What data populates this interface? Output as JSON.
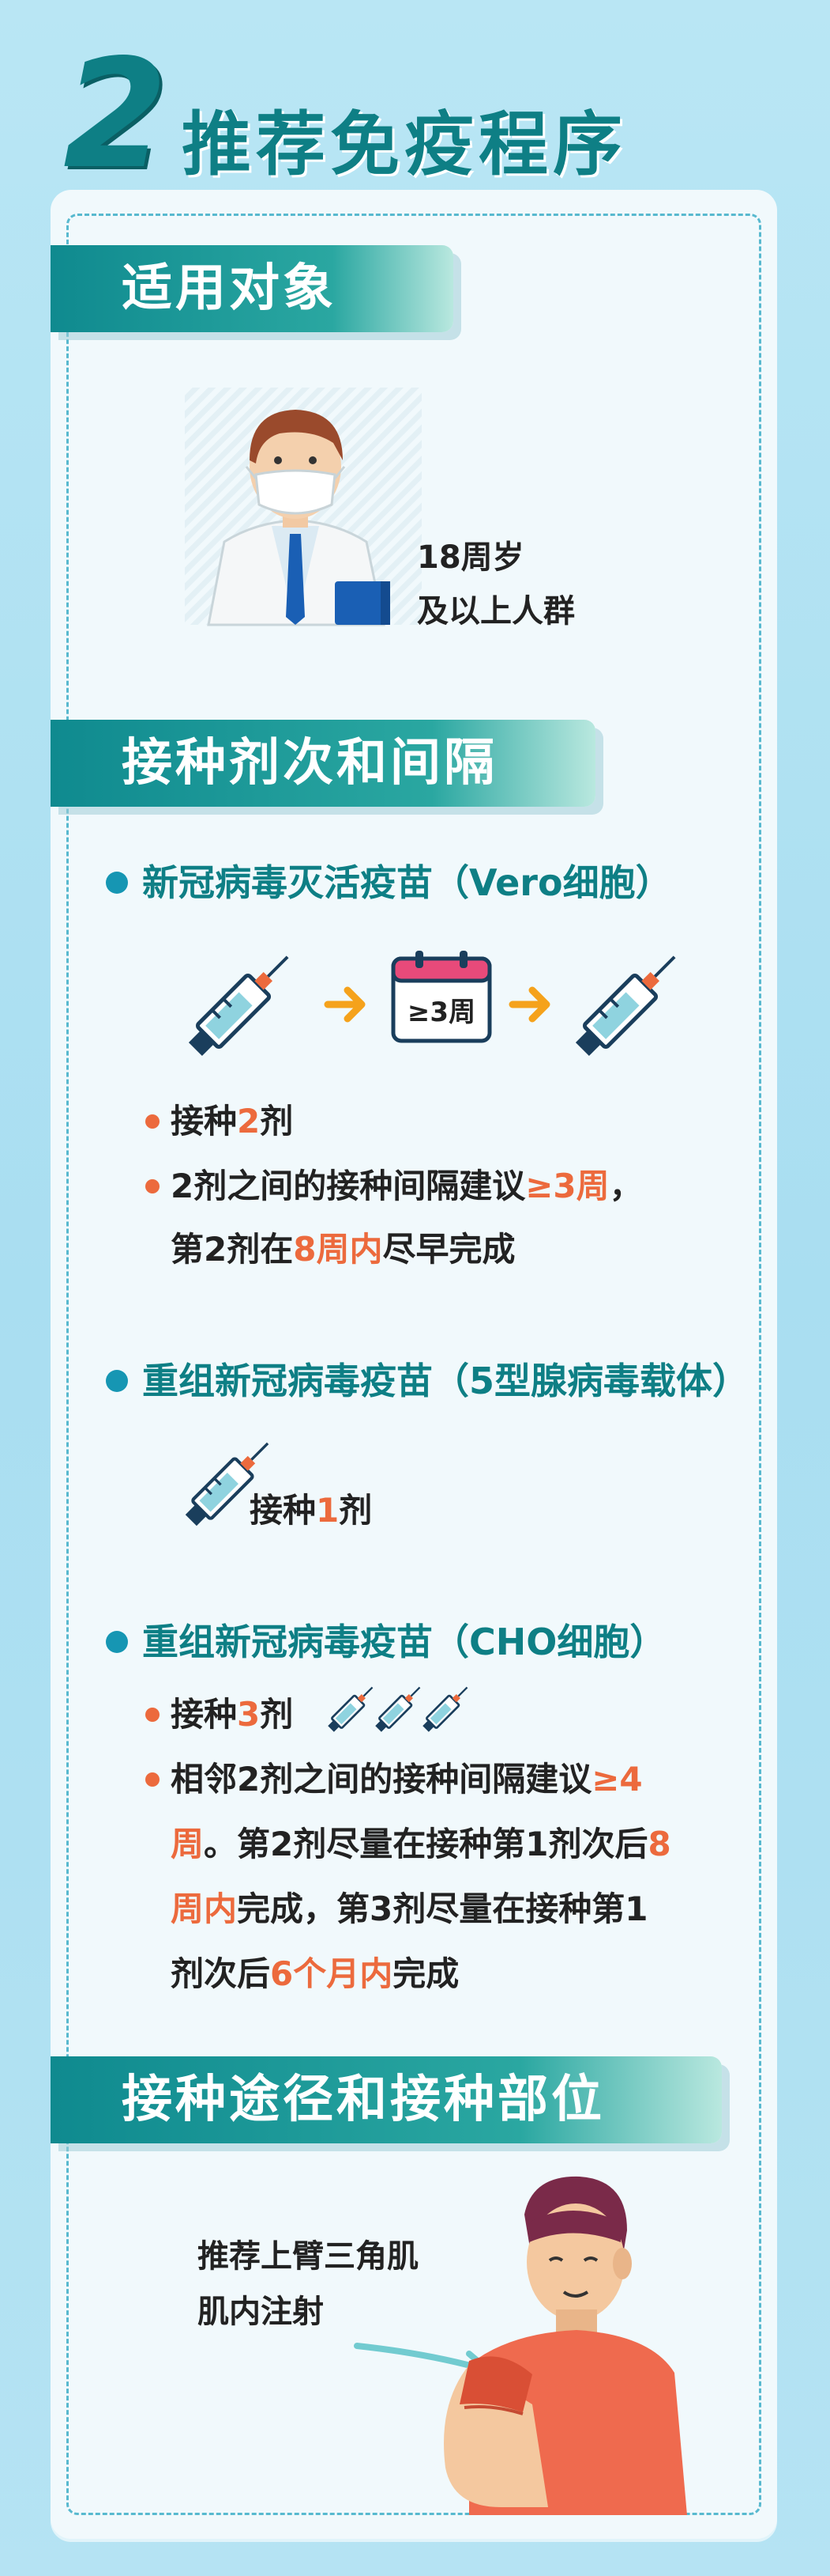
{
  "header": {
    "number": "2",
    "title": "推荐免疫程序"
  },
  "sections": {
    "target": {
      "banner": "适用对象",
      "line1": "18周岁",
      "line2": "及以上人群"
    },
    "doses": {
      "banner": "接种剂次和间隔",
      "vero": {
        "title": "新冠病毒灭活疫苗（Vero细胞）",
        "calendar_label": "≥3周",
        "item1_a": "接种",
        "item1_hl": "2",
        "item1_b": "剂",
        "item2_line1_a": "2剂之间的接种间隔建议",
        "item2_line1_hl": "≥3周",
        "item2_line1_b": "，",
        "item2_line2_a": "第2剂在",
        "item2_line2_hl": "8周内",
        "item2_line2_b": "尽早完成"
      },
      "adeno": {
        "title": "重组新冠病毒疫苗（5型腺病毒载体）",
        "item_a": "接种",
        "item_hl": "1",
        "item_b": "剂"
      },
      "cho": {
        "title": "重组新冠病毒疫苗（CHO细胞）",
        "item1_a": "接种",
        "item1_hl": "3",
        "item1_b": "剂",
        "l1_a": "相邻2剂之间的接种间隔建议",
        "l1_hl": "≥4",
        "l2_hl": "周",
        "l2_a": "。第2剂尽量在接种第1剂次后",
        "l2_hl2": "8",
        "l3_hl": "周内",
        "l3_a": "完成，第3剂尽量在接种第1",
        "l4_a": "剂次后",
        "l4_hl": "6个月内",
        "l4_b": "完成"
      }
    },
    "route": {
      "banner": "接种途径和接种部位",
      "line1": "推荐上臂三角肌",
      "line2": "肌内注射"
    }
  },
  "colors": {
    "teal": "#0e7f85",
    "orange": "#ec6a3d",
    "blue_dot": "#1696b3"
  }
}
